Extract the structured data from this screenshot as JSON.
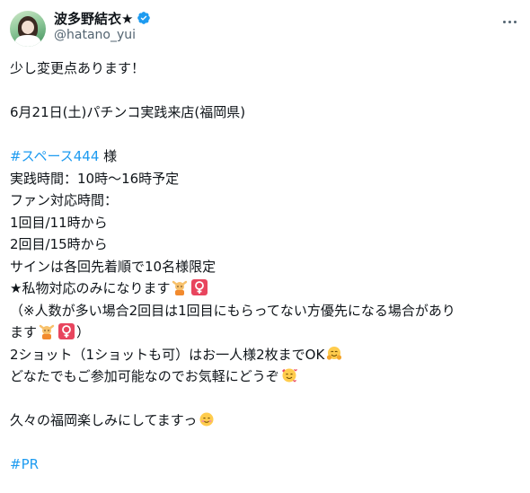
{
  "author": {
    "display_name": "波多野結衣★",
    "handle": "@hatano_yui",
    "verified": true
  },
  "icons": {
    "verified": "verified-badge-icon",
    "more": "more-options-icon"
  },
  "colors": {
    "link": "#1d9bf0",
    "text": "#0f1419",
    "secondary": "#536471"
  },
  "tweet": {
    "line1": "少し変更点あります！",
    "line2": "6月21日(土)パチンコ実践来店(福岡県)",
    "hashtag1": "#スペース444",
    "hashtag1_suffix": " 様",
    "line4": "実践時間：10時〜16時予定",
    "line5": "ファン対応時間：",
    "line6": "1回目/11時から",
    "line7": "2回目/15時から",
    "line8": "サインは各回先着順で10名様限定",
    "line9": "★私物対応のみになります",
    "line10": "（※人数が多い場合2回目は1回目にもらってない方優先になる場合があり",
    "line11a": "ます",
    "line11b": "）",
    "line12": "2ショット（1ショットも可）はお一人様2枚までOK",
    "line13": "どなたでもご参加可能なのでお気軽にどうぞ",
    "line14": "久々の福岡楽しみにしてますっ",
    "hashtag2": "#PR"
  }
}
